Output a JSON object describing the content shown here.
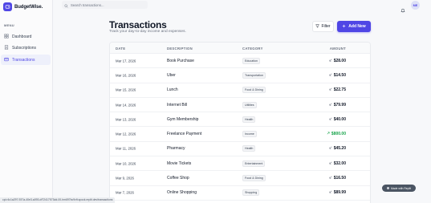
{
  "app": {
    "name": "BudgetWise."
  },
  "sidebar": {
    "menu_label": "MENU",
    "items": [
      {
        "label": "Dashboard",
        "icon": "grid-icon",
        "active": false
      },
      {
        "label": "Subscriptions",
        "icon": "receipt-icon",
        "active": false
      },
      {
        "label": "Transactions",
        "icon": "card-icon",
        "active": true
      }
    ]
  },
  "topbar": {
    "search_placeholder": "Search transactions...",
    "avatar_initials": "ME"
  },
  "page": {
    "title": "Transactions",
    "subtitle": "Track your day-to-day income and expenses.",
    "filter_label": "Filter",
    "add_label": "Add New"
  },
  "table": {
    "headers": {
      "date": "DATE",
      "description": "DESCRIPTION",
      "category": "CATEGORY",
      "amount": "AMOUNT"
    },
    "rows": [
      {
        "date": "Mar 17, 2026",
        "description": "Book Purchase",
        "category": "Education",
        "amount": "$28.00",
        "type": "expense"
      },
      {
        "date": "Mar 16, 2026",
        "description": "Uber",
        "category": "Transportation",
        "amount": "$14.50",
        "type": "expense"
      },
      {
        "date": "Mar 15, 2026",
        "description": "Lunch",
        "category": "Food & Dining",
        "amount": "$22.75",
        "type": "expense"
      },
      {
        "date": "Mar 14, 2026",
        "description": "Internet Bill",
        "category": "Utilities",
        "amount": "$79.99",
        "type": "expense"
      },
      {
        "date": "Mar 13, 2026",
        "description": "Gym Membership",
        "category": "Health",
        "amount": "$40.00",
        "type": "expense"
      },
      {
        "date": "Mar 12, 2026",
        "description": "Freelance Payment",
        "category": "Income",
        "amount": "$800.00",
        "type": "income"
      },
      {
        "date": "Mar 11, 2026",
        "description": "Pharmacy",
        "category": "Health",
        "amount": "$45.20",
        "type": "expense"
      },
      {
        "date": "Mar 10, 2026",
        "description": "Movie Tickets",
        "category": "Entertainment",
        "amount": "$32.00",
        "type": "expense"
      },
      {
        "date": "Mar 9, 2026",
        "description": "Coffee Shop",
        "category": "Food & Dining",
        "amount": "$16.50",
        "type": "expense"
      },
      {
        "date": "Mar 7, 2026",
        "description": "Online Shopping",
        "category": "Shopping",
        "amount": "$89.99",
        "type": "expense"
      }
    ]
  },
  "status_url": "cpi.r4c1a297-937a-40e3-a093-df72417573dd-00-hm697bc9vft.spock.replit.dev/transactions",
  "badge": {
    "label": "Made with Replit"
  },
  "colors": {
    "accent": "#4f46e5",
    "income": "#16a34a",
    "expense": "#111827"
  }
}
